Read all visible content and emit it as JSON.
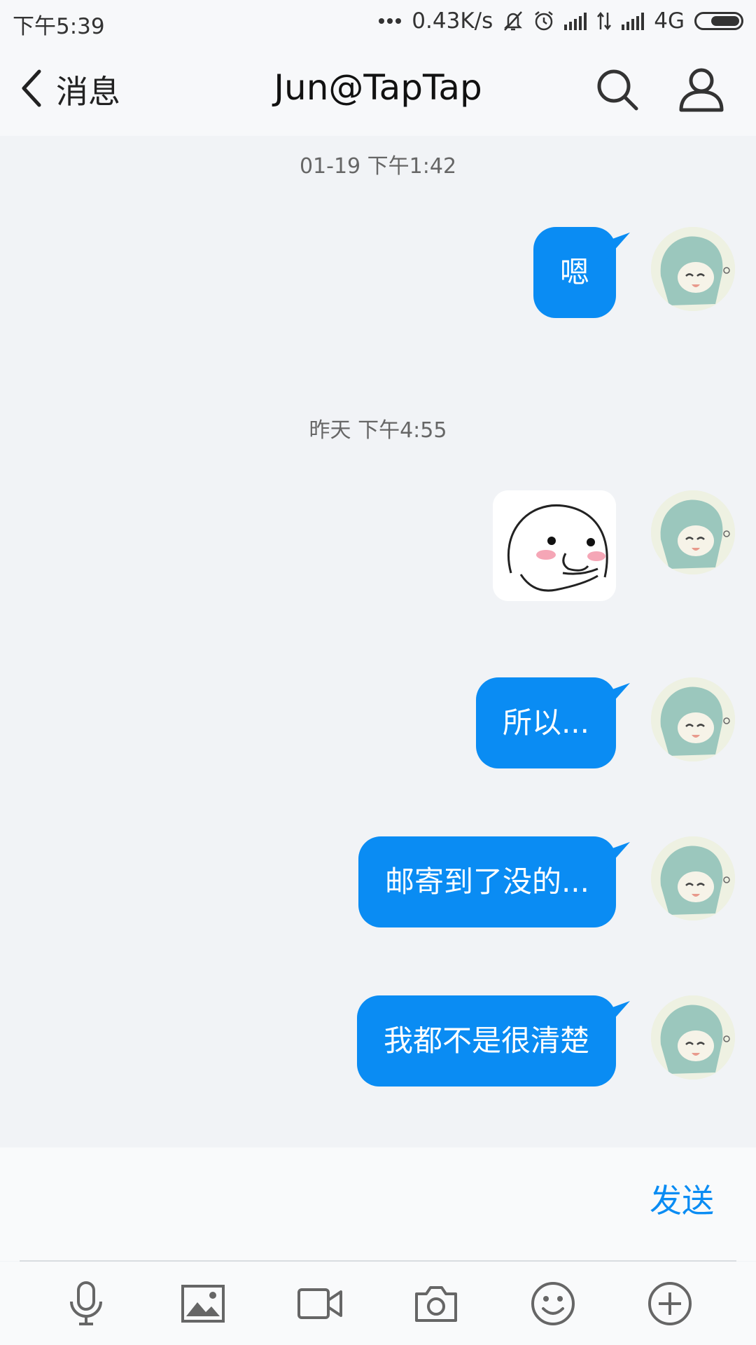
{
  "status_bar": {
    "time": "下午5:39",
    "network_speed": "0.43K/s",
    "network_type": "4G",
    "icons": [
      "dots-icon",
      "silent-bell-icon",
      "alarm-icon",
      "signal-icon",
      "data-arrows-icon",
      "signal-icon",
      "battery-icon"
    ]
  },
  "header": {
    "back_label": "消息",
    "title": "Jun@TapTap",
    "icons": [
      "back-chevron-icon",
      "search-icon",
      "profile-icon"
    ]
  },
  "messages": [
    {
      "type": "timestamp",
      "text": "01-19 下午1:42"
    },
    {
      "type": "text",
      "sender": "self",
      "text": "嗯"
    },
    {
      "type": "timestamp",
      "text": "昨天 下午4:55"
    },
    {
      "type": "sticker",
      "sender": "self",
      "icon": "blushing-face-sticker"
    },
    {
      "type": "text",
      "sender": "self",
      "text": "所以..."
    },
    {
      "type": "text",
      "sender": "self",
      "text": "邮寄到了没的..."
    },
    {
      "type": "text",
      "sender": "self",
      "text": "我都不是很清楚"
    }
  ],
  "composer": {
    "input_value": "",
    "send_label": "发送"
  },
  "toolbar": {
    "items": [
      "microphone-icon",
      "image-icon",
      "video-icon",
      "camera-icon",
      "emoji-icon",
      "add-icon"
    ]
  },
  "colors": {
    "bubble": "#0a8cf3",
    "send": "#0a8cf3",
    "background": "#f1f3f6"
  }
}
